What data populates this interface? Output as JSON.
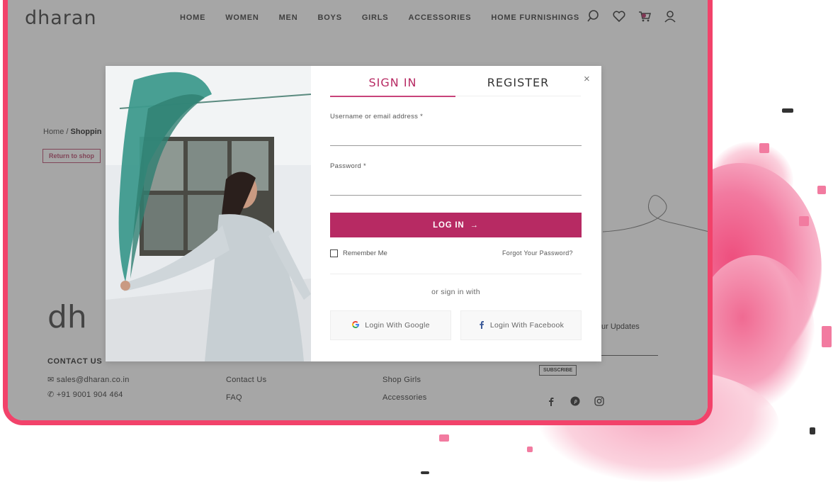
{
  "header": {
    "logo": "dharan",
    "nav": [
      "HOME",
      "WOMEN",
      "MEN",
      "BOYS",
      "GIRLS",
      "ACCESSORIES",
      "HOME FURNISHINGS"
    ]
  },
  "page": {
    "breadcrumb_home": "Home",
    "breadcrumb_sep": "/",
    "breadcrumb_current": "Shoppin",
    "return_label": "Return to shop"
  },
  "footer": {
    "logo": "dh",
    "contact_title": "CONTACT US",
    "email": "sales@dharan.co.in",
    "phone": "+91 9001 904 464",
    "col2": [
      "Contact Us",
      "FAQ"
    ],
    "col3": [
      "Shop Girls",
      "Accessories"
    ],
    "newsletter_text": "ur Updates",
    "subscribe_label": "SUBSCRIBE"
  },
  "modal": {
    "tab_signin": "SIGN IN",
    "tab_register": "REGISTER",
    "close_symbol": "×",
    "username_label": "Username or email address *",
    "password_label": "Password *",
    "login_label": "LOG IN",
    "login_arrow": "→",
    "remember_label": "Remember Me",
    "forgot_label": "Forgot Your Password?",
    "or_sign_in": "or sign in with",
    "google_label": "Login With Google",
    "facebook_label": "Login With Facebook"
  },
  "colors": {
    "brand": "#b72a63",
    "frame": "#f2426a",
    "facebook": "#3b5998"
  }
}
